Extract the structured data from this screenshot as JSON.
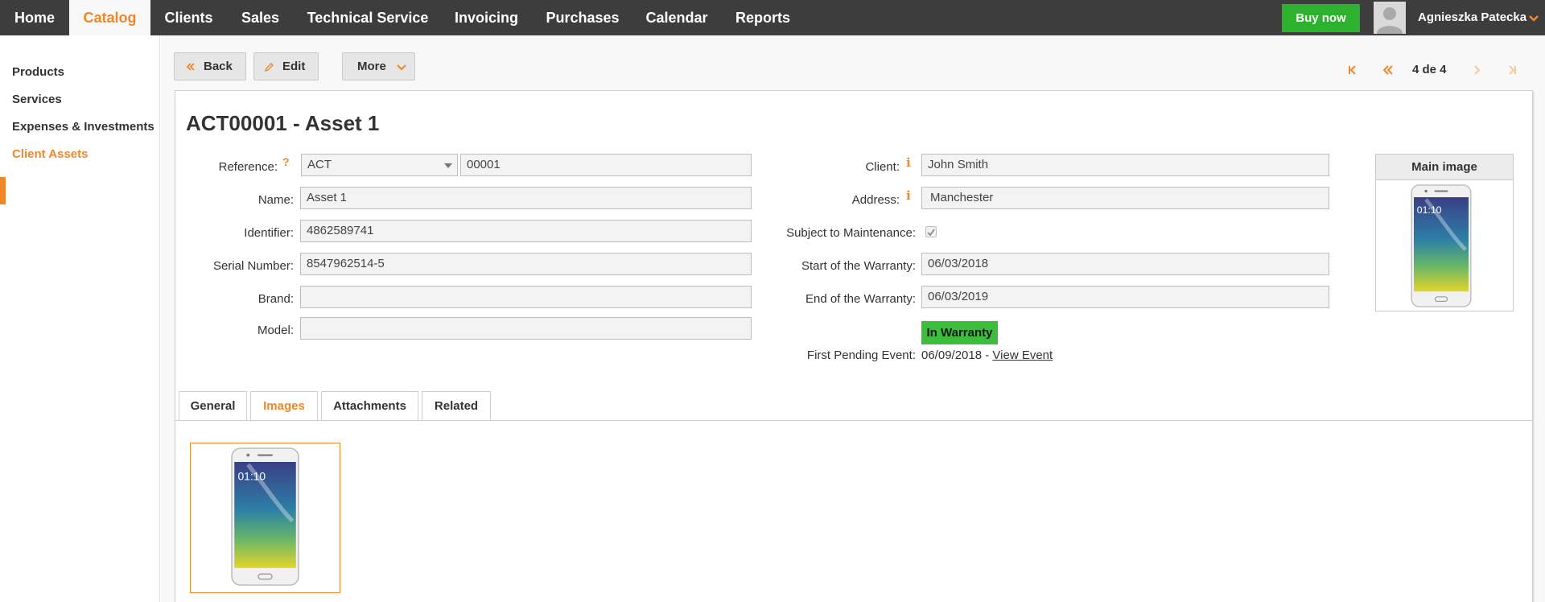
{
  "nav": {
    "items": [
      {
        "label": "Home",
        "active": false
      },
      {
        "label": "Catalog",
        "active": true
      },
      {
        "label": "Clients",
        "active": false
      },
      {
        "label": "Sales",
        "active": false
      },
      {
        "label": "Technical Service",
        "active": false
      },
      {
        "label": "Invoicing",
        "active": false
      },
      {
        "label": "Purchases",
        "active": false
      },
      {
        "label": "Calendar",
        "active": false
      },
      {
        "label": "Reports",
        "active": false
      }
    ],
    "buy_now": "Buy now",
    "user_name": "Agnieszka Patecka",
    "accent_color": "#f0882a",
    "buy_color": "#2db22d"
  },
  "sidebar": {
    "items": [
      {
        "label": "Products",
        "active": false
      },
      {
        "label": "Services",
        "active": false
      },
      {
        "label": "Expenses & Investments",
        "active": false
      },
      {
        "label": "Client Assets",
        "active": true
      }
    ]
  },
  "toolbar": {
    "back": "Back",
    "edit": "Edit",
    "more": "More"
  },
  "pager": {
    "text": "4 de 4"
  },
  "record": {
    "title": "ACT00001 - Asset 1",
    "help_mark": "?",
    "info_mark": "i",
    "left_fields": {
      "reference_label": "Reference:",
      "reference_series": "ACT",
      "reference_number": "00001",
      "name_label": "Name:",
      "name_value": "Asset 1",
      "identifier_label": "Identifier:",
      "identifier_value": "4862589741",
      "serial_label": "Serial Number:",
      "serial_value": "8547962514-5",
      "brand_label": "Brand:",
      "brand_value": "",
      "model_label": "Model:",
      "model_value": ""
    },
    "right_fields": {
      "client_label": "Client:",
      "client_value": "John Smith",
      "address_label": "Address:",
      "address_value": "Manchester",
      "maintenance_label": "Subject to Maintenance:",
      "maintenance_checked": true,
      "warranty_start_label": "Start of the Warranty:",
      "warranty_start_value": "06/03/2018",
      "warranty_end_label": "End of the Warranty:",
      "warranty_end_value": "06/03/2019",
      "warranty_status": "In Warranty",
      "warranty_status_color": "#3cbd3c",
      "pending_label": "First Pending Event:",
      "pending_date": "06/09/2018",
      "pending_sep": " - ",
      "pending_link": "View Event"
    },
    "main_image_label": "Main image"
  },
  "tabs": [
    {
      "label": "General",
      "active": false
    },
    {
      "label": "Images",
      "active": true
    },
    {
      "label": "Attachments",
      "active": false
    },
    {
      "label": "Related",
      "active": false
    }
  ],
  "phone": {
    "clock": "01:10"
  }
}
